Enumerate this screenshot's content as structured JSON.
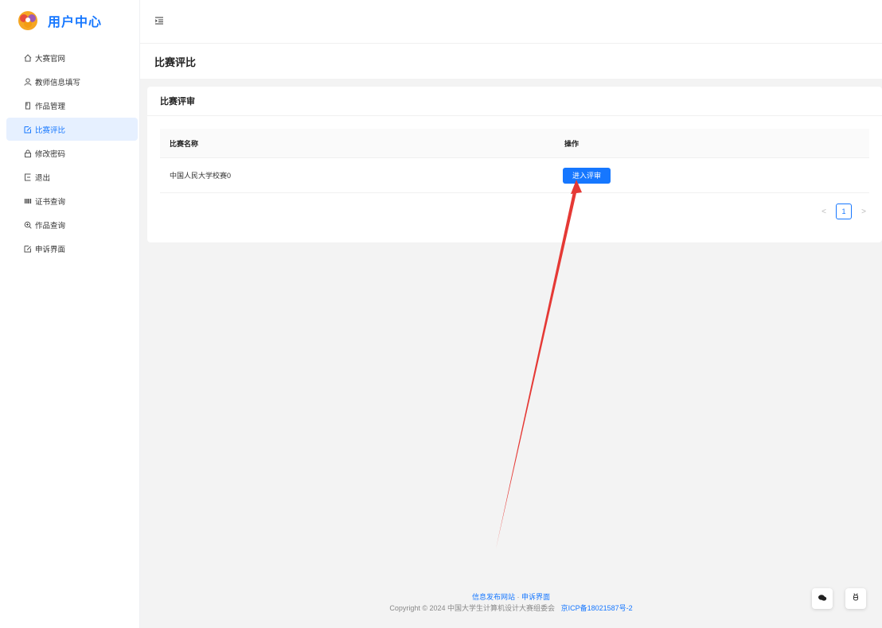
{
  "sidebar": {
    "logo_text": "用户中心",
    "items": [
      {
        "label": "大赛官网",
        "icon": "home-icon",
        "active": false
      },
      {
        "label": "教师信息填写",
        "icon": "user-icon",
        "active": false
      },
      {
        "label": "作品管理",
        "icon": "file-icon",
        "active": false
      },
      {
        "label": "比赛评比",
        "icon": "edit-icon",
        "active": true
      },
      {
        "label": "修改密码",
        "icon": "lock-icon",
        "active": false
      },
      {
        "label": "退出",
        "icon": "logout-icon",
        "active": false
      },
      {
        "label": "证书查询",
        "icon": "barcode-icon",
        "active": false
      },
      {
        "label": "作品查询",
        "icon": "zoom-icon",
        "active": false
      },
      {
        "label": "申诉界面",
        "icon": "form-icon",
        "active": false
      }
    ]
  },
  "page": {
    "title": "比赛评比"
  },
  "card": {
    "title": "比赛评审",
    "columns": [
      "比赛名称",
      "操作"
    ],
    "rows": [
      {
        "name": "中国人民大学校赛0",
        "action": "进入评审"
      }
    ]
  },
  "pagination": {
    "current": "1",
    "prev": "<",
    "next": ">"
  },
  "footer": {
    "link1": "信息发布网站",
    "separator": "·",
    "link2": "申诉界面",
    "copyright": "Copyright © 2024 中国大学生计算机设计大赛组委会",
    "icp": "京ICP备18021587号-2"
  },
  "colors": {
    "accent": "#1677ff",
    "annotation": "#e53935"
  }
}
